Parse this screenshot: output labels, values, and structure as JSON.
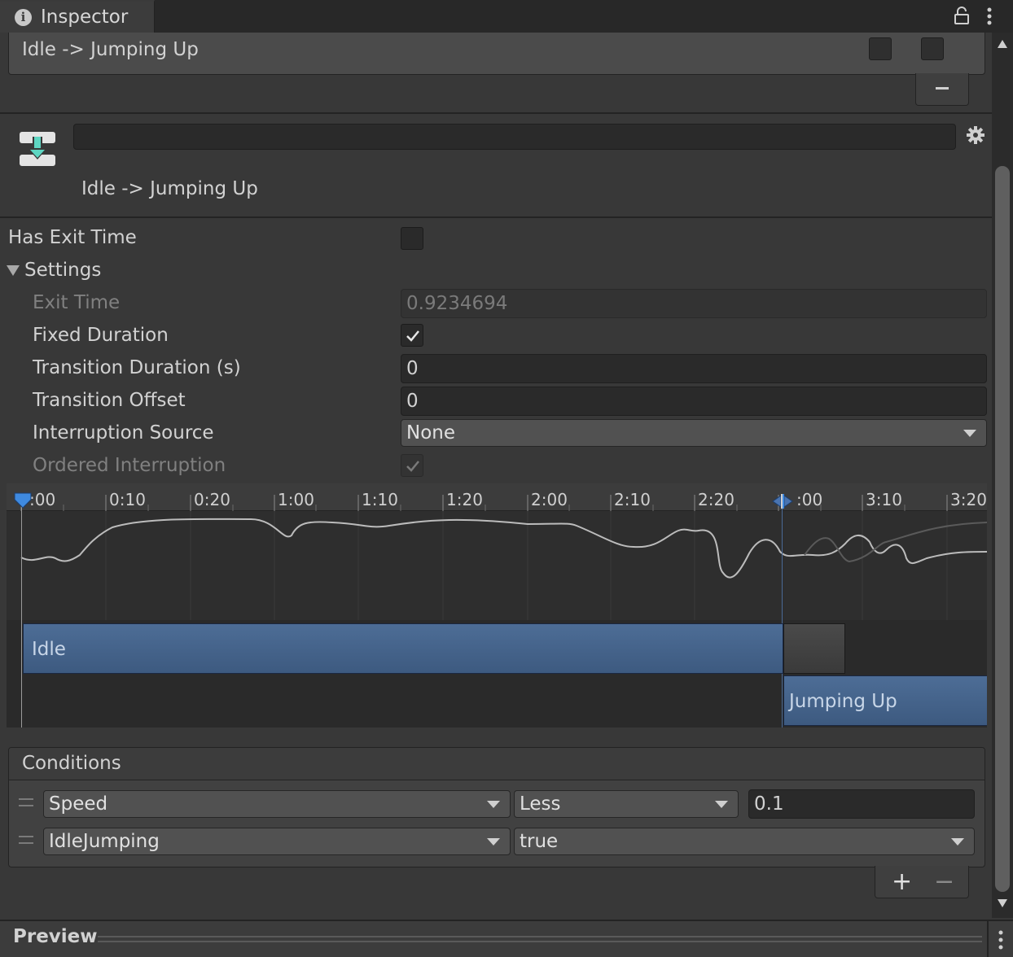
{
  "window": {
    "tab_title": "Inspector",
    "tab_icon": "info-icon",
    "lock_icon": "lock-icon",
    "menu_icon": "kebab-menu-icon"
  },
  "transition_list": {
    "items": [
      {
        "label": "Idle -> Jumping Up"
      }
    ],
    "remove_label": "−"
  },
  "header": {
    "icon": "transition-asset-icon",
    "name_value": "",
    "title": "Idle -> Jumping Up",
    "settings_icon": "gear-icon"
  },
  "properties": {
    "has_exit_time": {
      "label": "Has Exit Time",
      "checked": false
    },
    "settings_foldout": {
      "label": "Settings",
      "expanded": true
    },
    "exit_time": {
      "label": "Exit Time",
      "value": "0.9234694",
      "disabled": true
    },
    "fixed_duration": {
      "label": "Fixed Duration",
      "checked": true
    },
    "transition_duration": {
      "label": "Transition Duration (s)",
      "value": "0"
    },
    "transition_offset": {
      "label": "Transition Offset",
      "value": "0"
    },
    "interruption_source": {
      "label": "Interruption Source",
      "value": "None"
    },
    "ordered_interruption": {
      "label": "Ordered Interruption",
      "checked": true,
      "disabled": true
    }
  },
  "timeline": {
    "ticks": [
      ":00",
      "0:10",
      "0:20",
      "1:00",
      "1:10",
      "1:20",
      "2:00",
      "2:10",
      "2:20",
      "3:00",
      "3:10",
      "3:20"
    ],
    "tick_display": [
      ":00",
      "0:10",
      "0:20",
      "1:00",
      "1:10",
      "1:20",
      "2:00",
      "2:10",
      "2:20",
      ":00",
      "3:10",
      "3:20"
    ],
    "source_state": "Idle",
    "destination_state": "Jumping Up",
    "accent_color": "#4d6d96"
  },
  "conditions": {
    "title": "Conditions",
    "rows": [
      {
        "parameter": "Speed",
        "mode": "Less",
        "value": "0.1"
      },
      {
        "parameter": "IdleJumping",
        "value": "true"
      }
    ],
    "add_label": "+",
    "remove_label": "−"
  },
  "preview": {
    "title": "Preview"
  }
}
